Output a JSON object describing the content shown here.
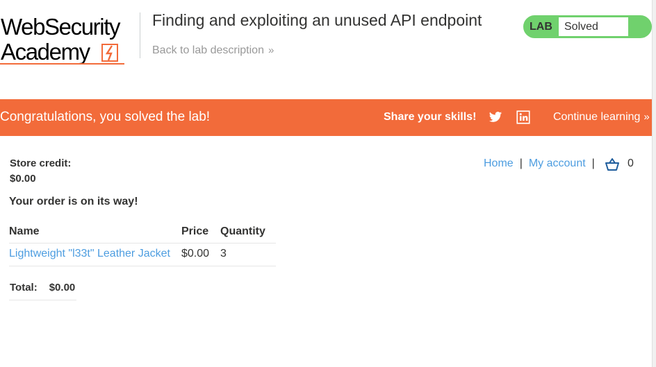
{
  "header": {
    "logo_line1": "WebSecurity",
    "logo_line2": "Academy",
    "lab_title": "Finding and exploiting an unused API endpoint",
    "back_link": "Back to lab description",
    "status_widget": {
      "tag": "LAB",
      "status": "Solved",
      "color": "#70d16d"
    }
  },
  "banner": {
    "message": "Congratulations, you solved the lab!",
    "share_label": "Share your skills!",
    "icons": [
      "twitter-icon",
      "linkedin-icon"
    ],
    "continue_label": "Continue learning",
    "color": "#f26b3a"
  },
  "nav": {
    "home": "Home",
    "separator": "|",
    "my_account": "My account",
    "cart_count": "0"
  },
  "account": {
    "store_credit_label": "Store credit:",
    "store_credit_value": "$0.00",
    "order_message": "Your order is on its way!"
  },
  "order_table": {
    "headers": {
      "name": "Name",
      "price": "Price",
      "quantity": "Quantity"
    },
    "rows": [
      {
        "name": "Lightweight \"l33t\" Leather Jacket",
        "price": "$0.00",
        "quantity": "3"
      }
    ]
  },
  "total": {
    "label": "Total:",
    "value": "$0.00"
  },
  "colors": {
    "link": "#4d9de0",
    "text": "#333332",
    "accent": "#f26b3a"
  }
}
